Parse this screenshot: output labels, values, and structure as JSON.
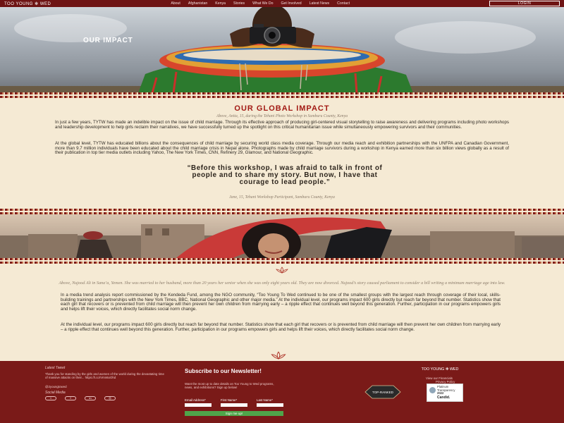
{
  "nav": {
    "brand": "TOO YOUNG ✻ WED",
    "links": [
      "About",
      "Afghanistan",
      "Kenya",
      "Stories",
      "What We Do",
      "Get Involved",
      "Latest News",
      "Contact"
    ],
    "login_label": "LOGIN"
  },
  "hero": {
    "title": "OUR IMPACT"
  },
  "impact": {
    "title": "OUR GLOBAL IMPACT",
    "caption": "Above, Anita, 15, during the Tehani Photo Workshop in Samburu County, Kenya",
    "para1": "In just a few years, TYTW has made an indelible impact on the issue of child marriage. Through its effective approach of producing girl-centered visual storytelling to raise awareness and delivering programs including photo workshops and leadership development to help girls reclaim their narratives, we have successfully turned up the spotlight on this critical humanitarian issue while simultaneously empowering survivors and their communities.",
    "para2": "At the global level, TYTW has educated billions about the consequences of child marriage by securing world class media coverage. Through our media reach and exhibition partnerships with the UNFPA and Canadian Government, more than 9.7 million individuals have been educated about the child marriage crisis in Nepal alone. Photographs made by child marriage survivors during a workshop in Kenya earned more than six billion views globally as a result of their publication in top tier media outlets including Yahoo, The New York Times, CNN, Refinery 29, Glamour, and National Geographic.",
    "quote": "“Before this workshop, I was afraid to talk in front of people and to share my story. But now, I have that courage to lead people.”",
    "quote_attribution": "Jane, 15, Tehani Workshop Participant, Samburu County, Kenya"
  },
  "story": {
    "caption": "Above, Nujood Ali in Sana’a, Yemen. She was married to her husband, more than 20 years her senior when she was only eight years old. They are now divorced. Nujood’s story caused parliament to consider a bill writing a minimum marriage age into law.",
    "para1": "In a media trend analysis report commissioned by the Kendeda Fund, among the NGO community, “Too Young To Wed continued to be one of the smallest groups with the largest reach through coverage of their local, skills-building trainings and partnerships with the New York Times, BBC, National Geographic and other major media.” At the individual level, our programs impact 600 girls directly but reach far beyond that number. Statistics show that each girl that recovers or is prevented from child marriage will then prevent her own children from marrying early – a ripple effect that continues well beyond this generation. Further, participation in our programs empowers girls and helps lift their voices, which directly facilitates social norm change.",
    "para2": "At the individual level, our programs impact 600 girls directly but reach far beyond that number. Statistics show that each girl that recovers or is prevented from child marriage will then prevent her own children from marrying early – a ripple effect that continues well beyond this generation. Further, participation in our programs empowers girls and helps lift their voices, which directly facilitates social norm change."
  },
  "footer": {
    "tweet_heading": "Latest Tweet",
    "tweet_text": "Thank you for standing by the girls and women of the world during the devastating time of massive attacks on their... https://t.co/Vmn6oOhd",
    "tweet_handle": "@2youngtowed",
    "social_heading": "Social Media",
    "social_icons": [
      "twitter-icon",
      "facebook-icon",
      "linkedin-icon",
      "instagram-icon"
    ],
    "newsletter_heading": "Subscribe to our Newsletter!",
    "newsletter_text": "Want the most up to date details on Too Young to Wed programs, news, and exhibitions? Sign up below!",
    "email_label": "Email Address*",
    "first_label": "First Name*",
    "last_label": "Last Name*",
    "signup_label": "Sign me up!",
    "brand": "TOO YOUNG ✻ WED",
    "financials_link": "View our Financials",
    "privacy_link": "Privacy Policy",
    "top_ranked_text": "TOP-RANKED",
    "badge_line1": "Platinum",
    "badge_line2": "Transparency",
    "badge_year": "2022",
    "badge_brand": "Candid."
  },
  "colors": {
    "nav": "#6e1414",
    "accent": "#a21a14",
    "background": "#f5ead4",
    "footer": "#7a1a18",
    "signup": "#4fa54a"
  }
}
